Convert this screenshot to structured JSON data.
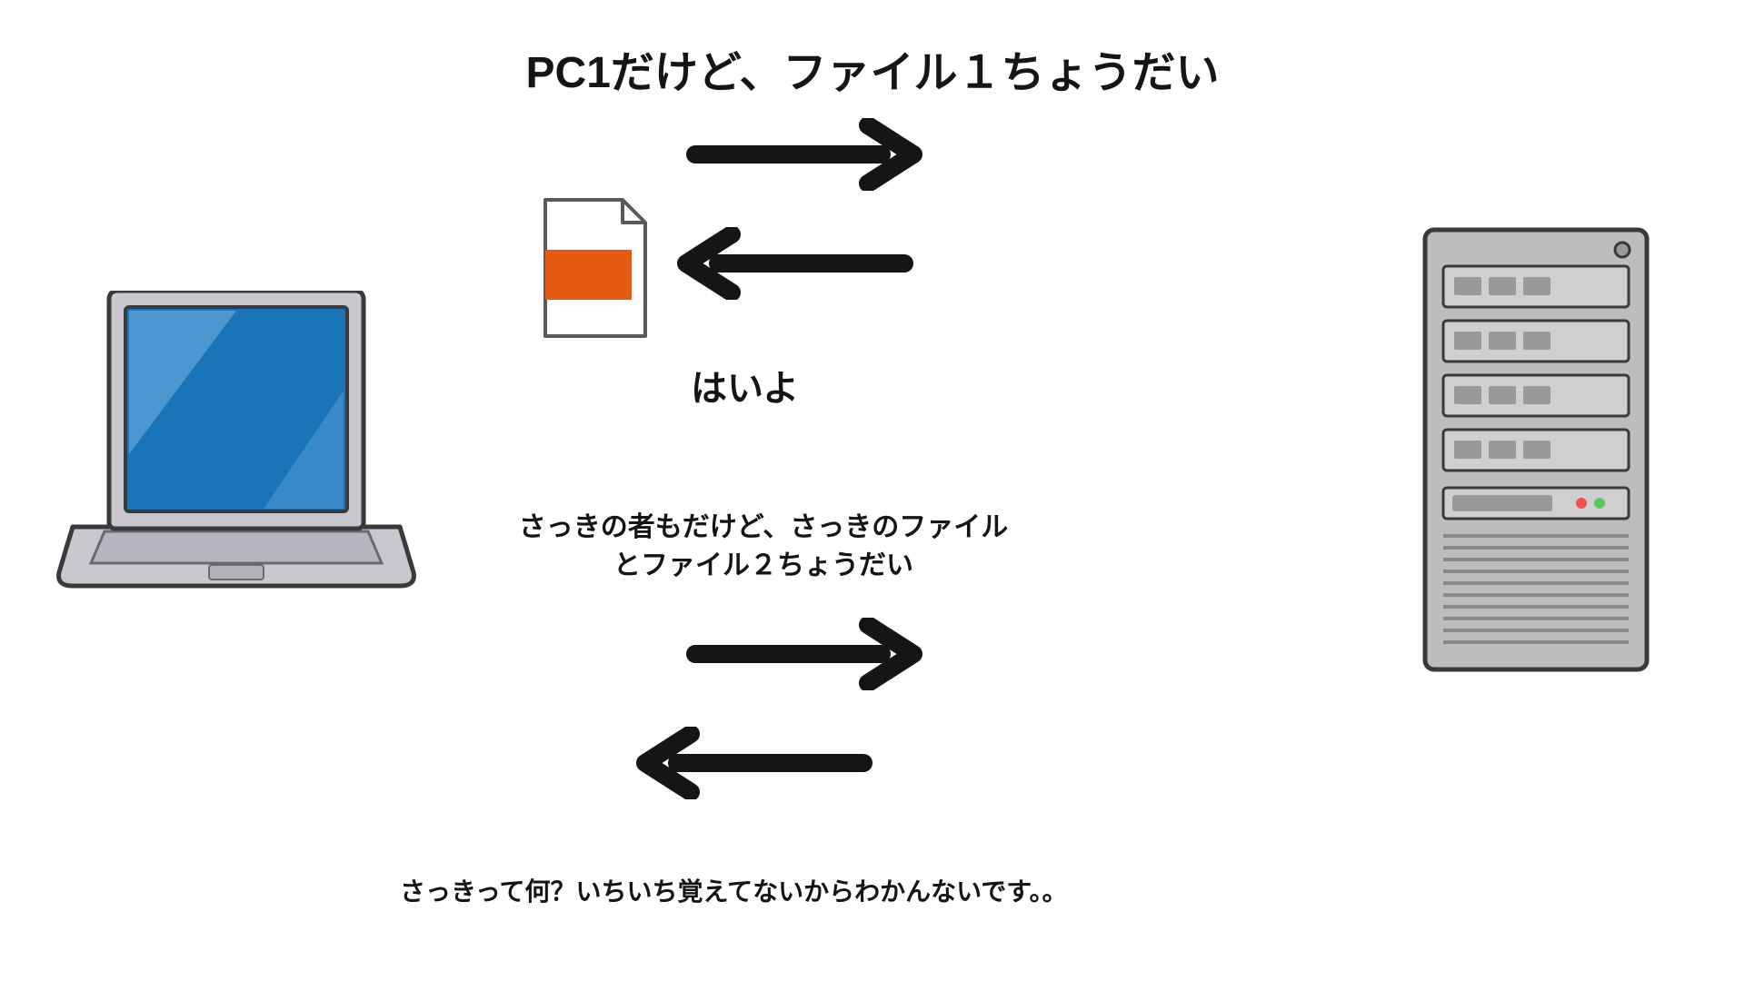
{
  "title": "PC1だけど、ファイル１ちょうだい",
  "reply1": "はいよ",
  "request2": "さっきの者もだけど、さっきのファイルとファイル２ちょうだい",
  "reply2": "さっきって何？いちいち覚えてないからわかんないです。。",
  "icons": {
    "laptop": "laptop-icon",
    "server": "server-icon",
    "file": "file-icon"
  }
}
